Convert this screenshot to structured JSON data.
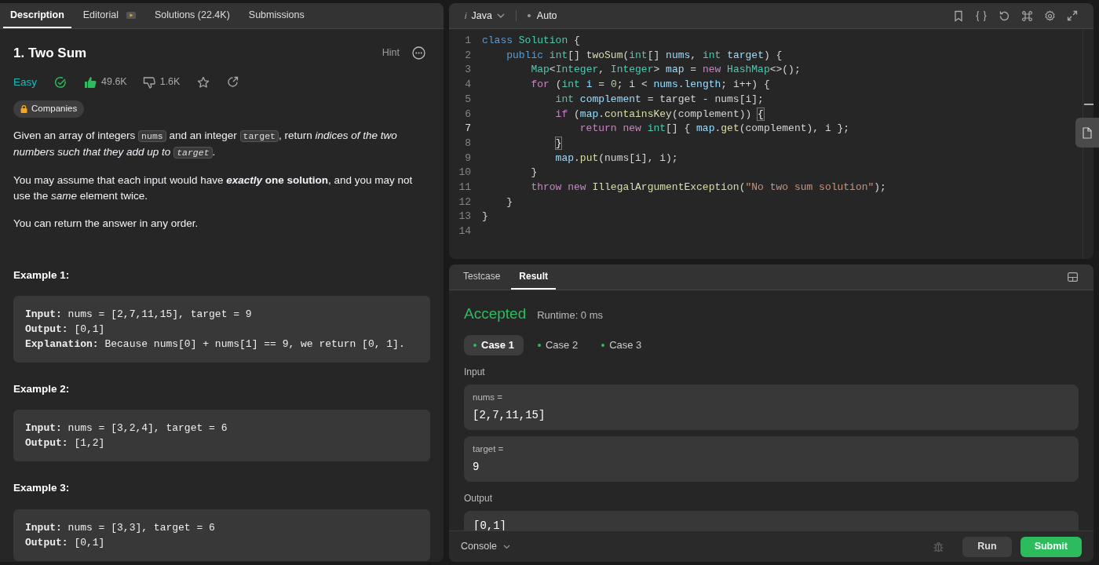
{
  "problem_tabs": [
    {
      "label": "Description",
      "selected": true
    },
    {
      "label": "Editorial",
      "selected": false,
      "video": true
    },
    {
      "label": "Solutions (22.4K)",
      "selected": false
    },
    {
      "label": "Submissions",
      "selected": false
    }
  ],
  "problem": {
    "title": "1. Two Sum",
    "hint": "Hint",
    "difficulty": "Easy",
    "solved": true,
    "likes": "49.6K",
    "liked": true,
    "dislikes": "1.6K",
    "companies": "Companies",
    "paragraphs": [
      [
        {
          "kind": "text",
          "text": "Given an array of integers "
        },
        {
          "kind": "code",
          "text": "nums"
        },
        {
          "kind": "text",
          "text": " and an integer "
        },
        {
          "kind": "code",
          "text": "target"
        },
        {
          "kind": "text",
          "text": ", return *indices of the two numbers such that they add up to* "
        },
        {
          "kind": "code-italic",
          "text": "target"
        },
        {
          "kind": "text",
          "text": "."
        }
      ],
      [
        {
          "kind": "text",
          "text": "You may assume that each input would have ***exactly* one solution**, and you may not use the *same* element twice."
        }
      ],
      [
        {
          "kind": "text",
          "text": "You can return the answer in any order."
        }
      ]
    ],
    "examples": [
      {
        "title": "Example 1:",
        "lines": [
          "**Input:** nums = [2,7,11,15], target = 9",
          "**Output:** [0,1]",
          "**Explanation:** Because nums[0] + nums[1] == 9, we return [0, 1]."
        ]
      },
      {
        "title": "Example 2:",
        "lines": [
          "**Input:** nums = [3,2,4], target = 6",
          "**Output:** [1,2]"
        ]
      },
      {
        "title": "Example 3:",
        "lines": [
          "**Input:** nums = [3,3], target = 6",
          "**Output:** [0,1]"
        ]
      }
    ]
  },
  "editor": {
    "language": "Java",
    "language_icon": "i",
    "mode": "Auto",
    "lines": [
      {
        "number": "1",
        "current": false,
        "tokens": [
          {
            "kind": "keyword",
            "text": "class "
          },
          {
            "kind": "type",
            "text": "Solution"
          },
          {
            "kind": "plain",
            "text": " {"
          }
        ]
      },
      {
        "number": "2",
        "current": false,
        "tokens": [
          {
            "kind": "keyword",
            "text": "    public "
          },
          {
            "kind": "type",
            "text": "int"
          },
          {
            "kind": "plain",
            "text": "[] "
          },
          {
            "kind": "func",
            "text": "twoSum"
          },
          {
            "kind": "plain",
            "text": "("
          },
          {
            "kind": "type",
            "text": "int"
          },
          {
            "kind": "plain",
            "text": "[] "
          },
          {
            "kind": "var",
            "text": "nums"
          },
          {
            "kind": "plain",
            "text": ", "
          },
          {
            "kind": "type",
            "text": "int "
          },
          {
            "kind": "var",
            "text": "target"
          },
          {
            "kind": "plain",
            "text": ") {"
          }
        ]
      },
      {
        "number": "3",
        "current": false,
        "tokens": [
          {
            "kind": "type",
            "text": "        Map"
          },
          {
            "kind": "plain",
            "text": "<"
          },
          {
            "kind": "type",
            "text": "Integer"
          },
          {
            "kind": "plain",
            "text": ", "
          },
          {
            "kind": "type",
            "text": "Integer"
          },
          {
            "kind": "plain",
            "text": "> "
          },
          {
            "kind": "var",
            "text": "map"
          },
          {
            "kind": "plain",
            "text": " = "
          },
          {
            "kind": "control",
            "text": "new "
          },
          {
            "kind": "type",
            "text": "HashMap"
          },
          {
            "kind": "plain",
            "text": "<>();"
          }
        ]
      },
      {
        "number": "4",
        "current": false,
        "tokens": [
          {
            "kind": "control",
            "text": "        for"
          },
          {
            "kind": "plain",
            "text": " ("
          },
          {
            "kind": "type",
            "text": "int "
          },
          {
            "kind": "var",
            "text": "i"
          },
          {
            "kind": "plain",
            "text": " = "
          },
          {
            "kind": "number",
            "text": "0"
          },
          {
            "kind": "plain",
            "text": "; i < "
          },
          {
            "kind": "var",
            "text": "nums.length"
          },
          {
            "kind": "plain",
            "text": "; i++) {"
          }
        ]
      },
      {
        "number": "5",
        "current": false,
        "tokens": [
          {
            "kind": "type",
            "text": "            int "
          },
          {
            "kind": "var",
            "text": "complement"
          },
          {
            "kind": "plain",
            "text": " = target - nums[i];"
          }
        ]
      },
      {
        "number": "6",
        "current": false,
        "tokens": [
          {
            "kind": "control",
            "text": "            if"
          },
          {
            "kind": "plain",
            "text": " ("
          },
          {
            "kind": "var",
            "text": "map"
          },
          {
            "kind": "plain",
            "text": "."
          },
          {
            "kind": "func",
            "text": "containsKey"
          },
          {
            "kind": "plain",
            "text": "(complement)) "
          },
          {
            "kind": "bracket",
            "text": "{"
          }
        ]
      },
      {
        "number": "7",
        "current": true,
        "tokens": [
          {
            "kind": "control",
            "text": "                return new "
          },
          {
            "kind": "type",
            "text": "int"
          },
          {
            "kind": "plain",
            "text": "[] { "
          },
          {
            "kind": "var",
            "text": "map"
          },
          {
            "kind": "plain",
            "text": "."
          },
          {
            "kind": "func",
            "text": "get"
          },
          {
            "kind": "plain",
            "text": "(complement), i };"
          }
        ]
      },
      {
        "number": "8",
        "current": false,
        "tokens": [
          {
            "kind": "bracket",
            "text": "            }"
          }
        ]
      },
      {
        "number": "9",
        "current": false,
        "tokens": [
          {
            "kind": "var",
            "text": "            map"
          },
          {
            "kind": "plain",
            "text": "."
          },
          {
            "kind": "func",
            "text": "put"
          },
          {
            "kind": "plain",
            "text": "(nums[i], i);"
          }
        ]
      },
      {
        "number": "10",
        "current": false,
        "tokens": [
          {
            "kind": "plain",
            "text": "        }"
          }
        ]
      },
      {
        "number": "11",
        "current": false,
        "tokens": [
          {
            "kind": "control",
            "text": "        throw new "
          },
          {
            "kind": "func",
            "text": "IllegalArgumentException"
          },
          {
            "kind": "plain",
            "text": "("
          },
          {
            "kind": "string",
            "text": "\"No two sum solution\""
          },
          {
            "kind": "plain",
            "text": ");"
          }
        ]
      },
      {
        "number": "12",
        "current": false,
        "tokens": [
          {
            "kind": "plain",
            "text": "    }"
          }
        ]
      },
      {
        "number": "13",
        "current": false,
        "tokens": [
          {
            "kind": "plain",
            "text": "}"
          }
        ]
      },
      {
        "number": "14",
        "current": false
      }
    ]
  },
  "result_tabs": [
    {
      "label": "Testcase",
      "selected": false
    },
    {
      "label": "Result",
      "selected": true
    }
  ],
  "result": {
    "verdict": "Accepted",
    "runtime": "Runtime: 0 ms",
    "cases": [
      {
        "label": "Case 1",
        "selected": true
      },
      {
        "label": "Case 2",
        "selected": false
      },
      {
        "label": "Case 3",
        "selected": false
      }
    ],
    "input_label": "Input",
    "inputs": [
      {
        "name": "nums =",
        "value": "[2,7,11,15]"
      },
      {
        "name": "target =",
        "value": "9"
      }
    ],
    "output_label": "Output",
    "output": "[0,1]"
  },
  "footer": {
    "console": "Console",
    "run": "Run",
    "submit": "Submit"
  }
}
